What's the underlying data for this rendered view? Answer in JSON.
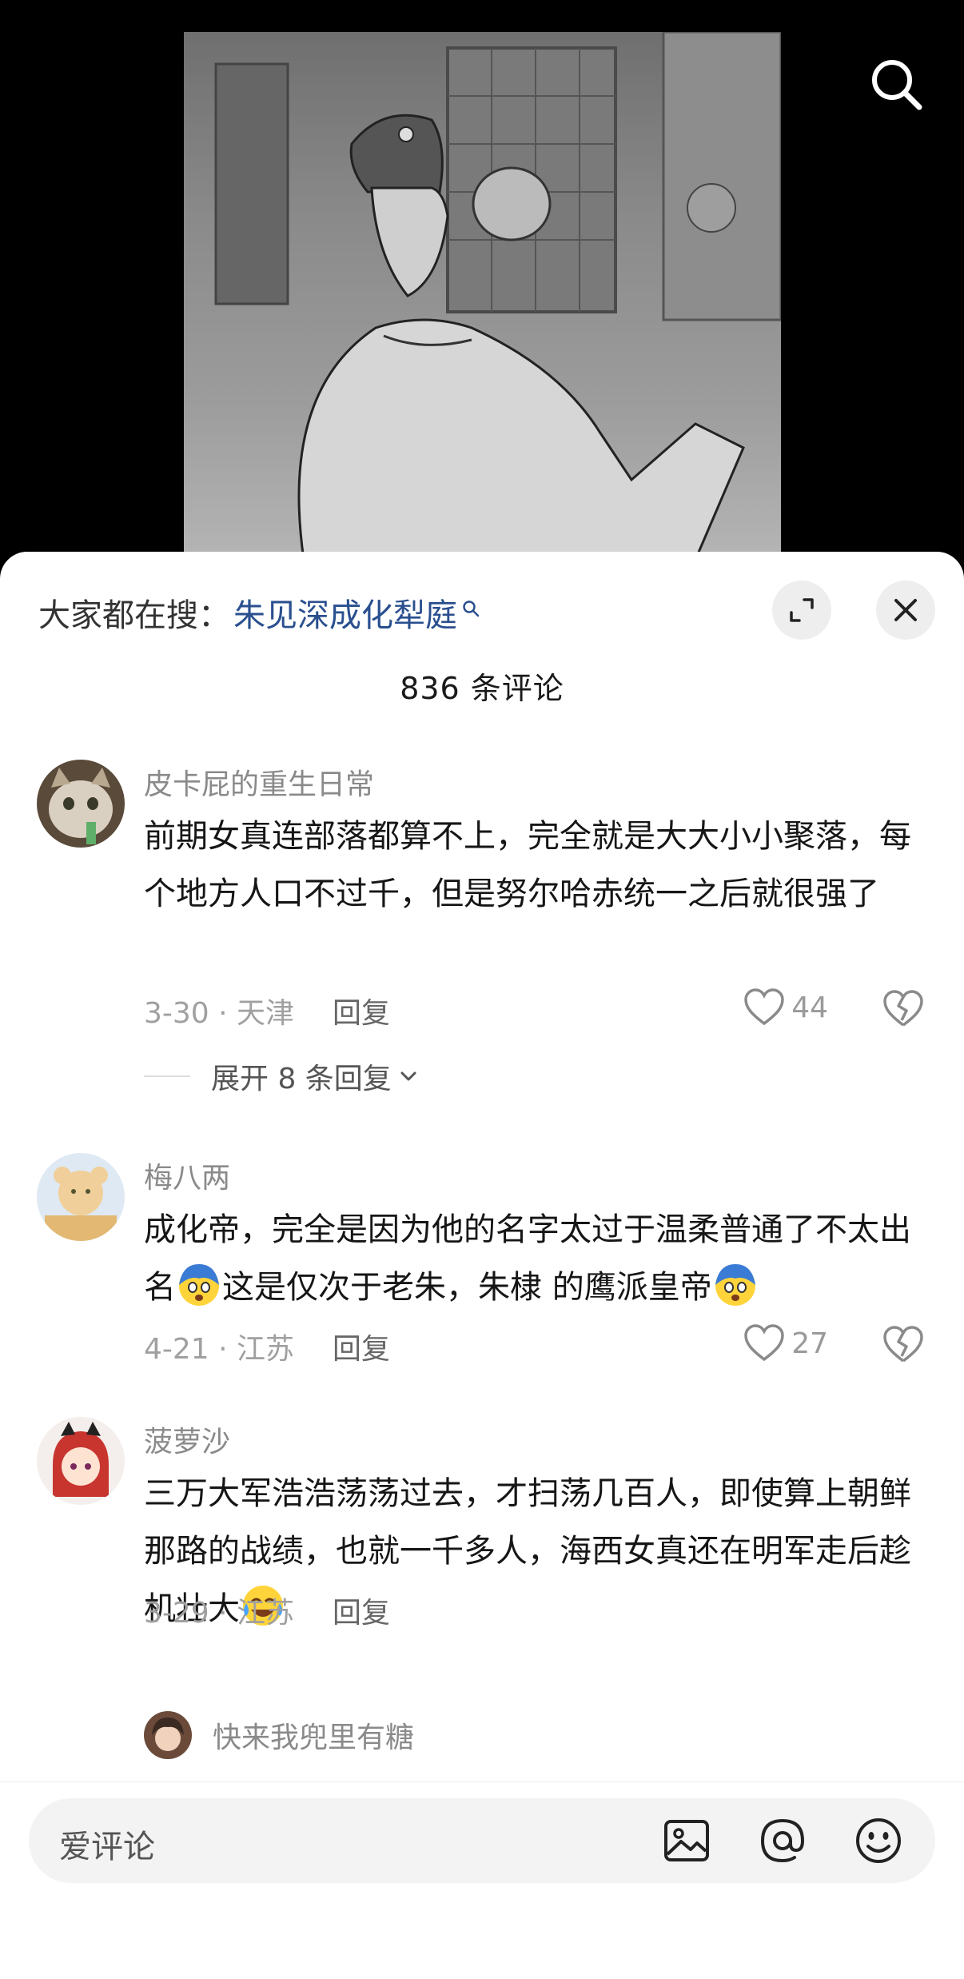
{
  "search_hint": {
    "prefix": "大家都在搜：",
    "keyword": "朱见深成化犁庭"
  },
  "comment_count": "836 条评论",
  "comments": [
    {
      "username": "皮卡屁的重生日常",
      "text": "前期女真连部落都算不上，完全就是大大小小聚落，每个地方人口不过千，但是努尔哈赤统一之后就很强了",
      "date_location": "3-30 · 天津",
      "reply_label": "回复",
      "likes": "44"
    },
    {
      "username": "梅八两",
      "text_part1": "成化帝，完全是因为他的名字太过于温柔普通了不太出名",
      "text_part2": "这是仅次于老朱，朱棣 的鹰派皇帝",
      "date_location": "4-21 · 江苏",
      "reply_label": "回复",
      "likes": "27"
    },
    {
      "username": "菠萝沙",
      "text": "三万大军浩浩荡荡过去，才扫荡几百人，即使算上朝鲜那路的战绩，也就一千多人，海西女真还在明军走后趁机壮大",
      "date_location": "3-29 · 江苏",
      "reply_label": "回复"
    }
  ],
  "expand_replies_label": "展开 8 条回复",
  "sub_reply_username": "快来我兜里有糖",
  "input": {
    "placeholder": "爱评论"
  },
  "icons": {
    "top_search": "search-icon",
    "expand": "expand-icon",
    "close": "close-icon",
    "like": "heart-icon",
    "dislike": "broken-heart-icon",
    "image": "image-icon",
    "mention": "at-icon",
    "emoji": "emoji-icon"
  }
}
